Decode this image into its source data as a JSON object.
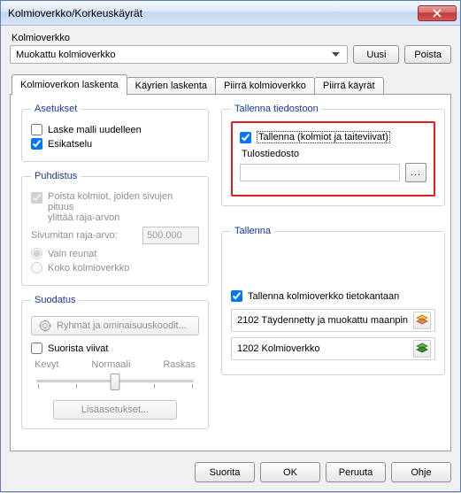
{
  "window": {
    "title": "Kolmioverkko/Korkeuskäyrät"
  },
  "top": {
    "label": "Kolmioverkko",
    "combo_value": "Muokattu kolmioverkko",
    "btn_new": "Uusi",
    "btn_delete": "Poista"
  },
  "tabs": {
    "t0": "Kolmioverkon laskenta",
    "t1": "Käyrien laskenta",
    "t2": "Piirrä kolmioverkko",
    "t3": "Piirrä käyrät"
  },
  "settings": {
    "legend": "Asetukset",
    "recalc": "Laske malli uudelleen",
    "preview": "Esikatselu"
  },
  "cleanup": {
    "legend": "Puhdistus",
    "removeTriangles_l1": "Poista kolmiot, joiden sivujen pituus",
    "removeTriangles_l2": "ylittää raja-arvon",
    "sideLimitLabel": "Sivumitan raja-arvo:",
    "sideLimitValue": "500.000",
    "edgesOnly": "Vain reunat",
    "wholeMesh": "Koko kolmioverkko"
  },
  "filter": {
    "legend": "Suodatus",
    "groupsBtn": "Ryhmät ja ominaisuuskoodit...",
    "straighten": "Suorista viivat",
    "slider_light": "Kevyt",
    "slider_normal": "Normaali",
    "slider_heavy": "Raskas",
    "advancedBtn": "Lisäasetukset..."
  },
  "saveFile": {
    "legend": "Tallenna tiedostoon",
    "chk": "Tallenna (kolmiot ja taiteviivat)",
    "outLabel": "Tulostiedosto",
    "outValue": ""
  },
  "save": {
    "legend": "Tallenna",
    "chk": "Tallenna kolmioverkko tietokantaan",
    "row1": "2102 Täydennetty ja muokattu maanpin",
    "row2": "1202 Kolmioverkko"
  },
  "footer": {
    "run": "Suorita",
    "ok": "OK",
    "cancel": "Peruuta",
    "help": "Ohje"
  },
  "colors": {
    "highlight": "#e02020",
    "legend": "#13399b"
  }
}
